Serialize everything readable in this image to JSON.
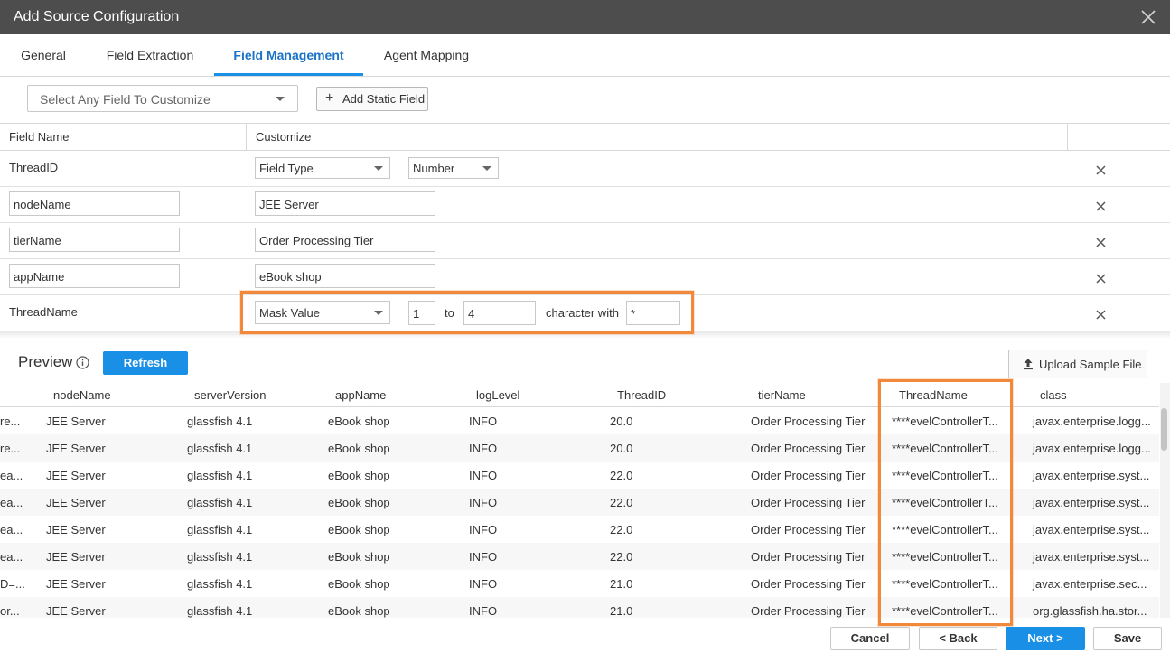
{
  "window": {
    "title": "Add Source Configuration"
  },
  "tabs": [
    {
      "label": "General"
    },
    {
      "label": "Field Extraction"
    },
    {
      "label": "Field Management"
    },
    {
      "label": "Agent Mapping"
    }
  ],
  "toolbar": {
    "field_select": "Select Any Field To Customize",
    "add_static_label": "Add Static Field"
  },
  "grid": {
    "headers": {
      "field_name": "Field Name",
      "customize": "Customize"
    },
    "rows": {
      "threadid": {
        "name": "ThreadID",
        "type_select": "Field Type",
        "value_select": "Number"
      },
      "nodename": {
        "name": "nodeName",
        "value": "JEE Server"
      },
      "tiername": {
        "name": "tierName",
        "value": "Order Processing Tier"
      },
      "appname": {
        "name": "appName",
        "value": "eBook shop"
      },
      "threadname": {
        "name": "ThreadName",
        "mode": "Mask Value",
        "from": "1",
        "to_label": "to",
        "to": "4",
        "char_label": "character with",
        "char": "*"
      }
    }
  },
  "preview": {
    "title": "Preview",
    "refresh_label": "Refresh",
    "upload_label": "Upload Sample File",
    "columns": [
      "nodeName",
      "serverVersion",
      "appName",
      "logLevel",
      "ThreadID",
      "tierName",
      "ThreadName",
      "class"
    ],
    "rows": [
      {
        "prefix": "re...",
        "cells": [
          "JEE Server",
          "glassfish 4.1",
          "eBook shop",
          "INFO",
          "20.0",
          "Order Processing Tier",
          "****evelControllerT...",
          "javax.enterprise.logg..."
        ]
      },
      {
        "prefix": "re...",
        "cells": [
          "JEE Server",
          "glassfish 4.1",
          "eBook shop",
          "INFO",
          "20.0",
          "Order Processing Tier",
          "****evelControllerT...",
          "javax.enterprise.logg..."
        ]
      },
      {
        "prefix": "ea...",
        "cells": [
          "JEE Server",
          "glassfish 4.1",
          "eBook shop",
          "INFO",
          "22.0",
          "Order Processing Tier",
          "****evelControllerT...",
          "javax.enterprise.syst..."
        ]
      },
      {
        "prefix": "ea...",
        "cells": [
          "JEE Server",
          "glassfish 4.1",
          "eBook shop",
          "INFO",
          "22.0",
          "Order Processing Tier",
          "****evelControllerT...",
          "javax.enterprise.syst..."
        ]
      },
      {
        "prefix": "ea...",
        "cells": [
          "JEE Server",
          "glassfish 4.1",
          "eBook shop",
          "INFO",
          "22.0",
          "Order Processing Tier",
          "****evelControllerT...",
          "javax.enterprise.syst..."
        ]
      },
      {
        "prefix": "ea...",
        "cells": [
          "JEE Server",
          "glassfish 4.1",
          "eBook shop",
          "INFO",
          "22.0",
          "Order Processing Tier",
          "****evelControllerT...",
          "javax.enterprise.syst..."
        ]
      },
      {
        "prefix": "D=...",
        "cells": [
          "JEE Server",
          "glassfish 4.1",
          "eBook shop",
          "INFO",
          "21.0",
          "Order Processing Tier",
          "****evelControllerT...",
          "javax.enterprise.sec..."
        ]
      },
      {
        "prefix": "or...",
        "cells": [
          "JEE Server",
          "glassfish 4.1",
          "eBook shop",
          "INFO",
          "21.0",
          "Order Processing Tier",
          "****evelControllerT...",
          "org.glassfish.ha.stor..."
        ]
      }
    ]
  },
  "footer": {
    "cancel": "Cancel",
    "back": "< Back",
    "next": "Next >",
    "save": "Save"
  },
  "colors": {
    "accent": "#1a8fe6",
    "highlight": "#f2883a",
    "titlebar": "#4d4d4d"
  }
}
